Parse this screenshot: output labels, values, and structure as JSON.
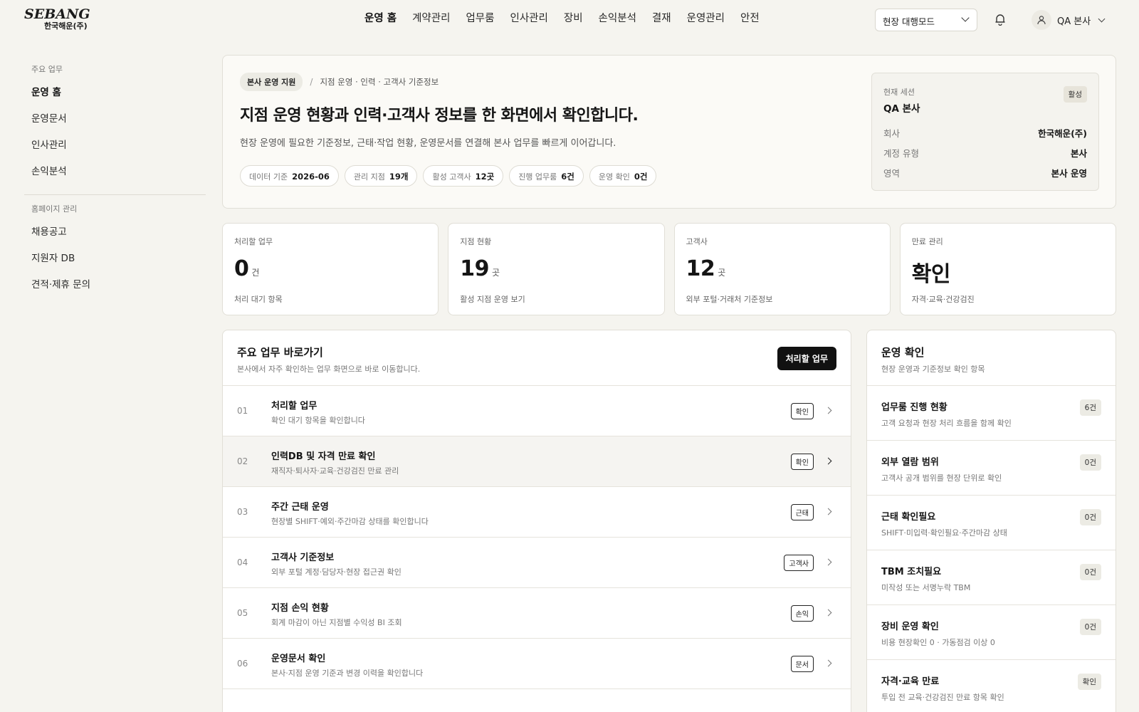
{
  "brand": {
    "name": "SEBANG",
    "sub": "한국해운(주)"
  },
  "nav": [
    "운영 홈",
    "계약관리",
    "업무룸",
    "인사관리",
    "장비",
    "손익분석",
    "결재",
    "운영관리",
    "안전"
  ],
  "mode_select": {
    "value": "현장 대행모드"
  },
  "user": {
    "name": "QA 본사"
  },
  "sidebar": {
    "groups": [
      {
        "title": "주요 업무",
        "items": [
          "운영 홈",
          "운영문서",
          "인사관리",
          "손익분석"
        ]
      },
      {
        "title": "홈페이지 관리",
        "items": [
          "채용공고",
          "지원자 DB",
          "견적·제휴 문의"
        ]
      }
    ]
  },
  "hero": {
    "badge": "본사 운영 지원",
    "separator": "/",
    "path": "지점 운영 · 인력 · 고객사 기준정보",
    "title": "지점 운영 현황과 인력·고객사 정보를 한 화면에서 확인합니다.",
    "desc": "현장 운영에 필요한 기준정보, 근태·작업 현황, 운영문서를 연결해 본사 업무를 빠르게 이어갑니다.",
    "chips": [
      {
        "label": "데이터 기준",
        "value": "2026-06"
      },
      {
        "label": "관리 지점",
        "value": "19개"
      },
      {
        "label": "활성 고객사",
        "value": "12곳"
      },
      {
        "label": "진행 업무룸",
        "value": "6건"
      },
      {
        "label": "운영 확인",
        "value": "0건"
      }
    ]
  },
  "session": {
    "label": "현재 세션",
    "name": "QA 본사",
    "badge": "활성",
    "rows": [
      {
        "k": "회사",
        "v": "한국해운(주)"
      },
      {
        "k": "계정 유형",
        "v": "본사"
      },
      {
        "k": "영역",
        "v": "본사 운영"
      }
    ]
  },
  "stats": [
    {
      "label": "처리할 업무",
      "value": "0",
      "unit": "건",
      "sub": "처리 대기 항목"
    },
    {
      "label": "지점 현황",
      "value": "19",
      "unit": "곳",
      "sub": "활성 지점 운영 보기"
    },
    {
      "label": "고객사",
      "value": "12",
      "unit": "곳",
      "sub": "외부 포털·거래처 기준정보"
    },
    {
      "label": "만료 관리",
      "value": "확인",
      "unit": "",
      "sub": "자격·교육·건강검진"
    }
  ],
  "shortcuts": {
    "title": "주요 업무 바로가기",
    "sub": "본사에서 자주 확인하는 업무 화면으로 바로 이동합니다.",
    "button": "처리할 업무",
    "rows": [
      {
        "num": "01",
        "title": "처리할 업무",
        "sub": "확인 대기 항목을 확인합니다",
        "tag": "확인"
      },
      {
        "num": "02",
        "title": "인력DB 및 자격 만료 확인",
        "sub": "재직자·퇴사자·교육·건강검진 만료 관리",
        "tag": "확인"
      },
      {
        "num": "03",
        "title": "주간 근태 운영",
        "sub": "현장별 SHIFT·예외·주간마감 상태를 확인합니다",
        "tag": "근태"
      },
      {
        "num": "04",
        "title": "고객사 기준정보",
        "sub": "외부 포털 계정·담당자·현장 접근권 확인",
        "tag": "고객사"
      },
      {
        "num": "05",
        "title": "지점 손익 현황",
        "sub": "회계 마감이 아닌 지점별 수익성 BI 조회",
        "tag": "손익"
      },
      {
        "num": "06",
        "title": "운영문서 확인",
        "sub": "본사·지점 운영 기준과 변경 이력을 확인합니다",
        "tag": "문서"
      }
    ]
  },
  "ops": {
    "title": "운영 확인",
    "sub": "현장 운영과 기준정보 확인 항목",
    "rows": [
      {
        "title": "업무룸 진행 현황",
        "sub": "고객 요청과 현장 처리 흐름을 함께 확인",
        "badge": "6건"
      },
      {
        "title": "외부 열람 범위",
        "sub": "고객사 공개 범위를 현장 단위로 확인",
        "badge": "0건"
      },
      {
        "title": "근태 확인필요",
        "sub": "SHIFT·미입력·확인필요·주간마감 상태",
        "badge": "0건"
      },
      {
        "title": "TBM 조치필요",
        "sub": "미작성 또는 서명누락 TBM",
        "badge": "0건"
      },
      {
        "title": "장비 운영 확인",
        "sub": "비용 현장확인 0 · 가동점검 이상 0",
        "badge": "0건"
      },
      {
        "title": "자격·교육 만료",
        "sub": "투입 전 교육·건강검진 만료 항목 확인",
        "badge": "확인"
      }
    ]
  }
}
